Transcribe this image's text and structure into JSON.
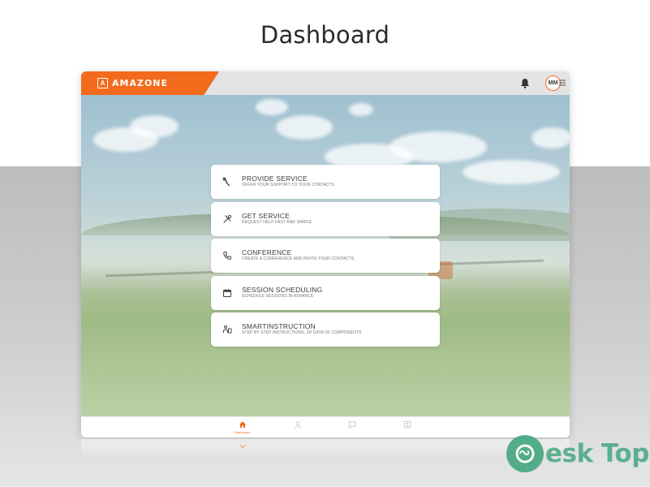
{
  "page": {
    "heading": "Dashboard"
  },
  "app": {
    "brand": {
      "logo_letter": "A",
      "name": "AMAZONE",
      "color": "#f26a1b"
    },
    "header": {
      "avatar_initials": "MM",
      "bell_icon": "bell-icon",
      "menu_icon": "menu-icon"
    }
  },
  "services": [
    {
      "title": "PROVIDE SERVICE",
      "subtitle": "OFFER YOUR SUPPORT TO YOUR CONTACTS",
      "icon": "wrench-icon"
    },
    {
      "title": "GET SERVICE",
      "subtitle": "REQUEST HELP FAST AND SIMPLE",
      "icon": "tools-icon"
    },
    {
      "title": "CONFERENCE",
      "subtitle": "CREATE A CONFERENCE AND INVITE YOUR CONTACTS",
      "icon": "phone-icon"
    },
    {
      "title": "SESSION SCHEDULING",
      "subtitle": "SCHEDULE SESSIONS IN ADVANCE",
      "icon": "calendar-icon"
    },
    {
      "title": "SMARTINSTRUCTION",
      "subtitle": "STEP BY STEP INSTRUCTIONS, 3D DATA OF COMPONENTS",
      "icon": "instruction-icon"
    }
  ],
  "bottom_nav": [
    {
      "label": "Dashboard",
      "icon": "home-icon",
      "active": true
    },
    {
      "label": "",
      "icon": "service-icon",
      "active": false
    },
    {
      "label": "",
      "icon": "chat-icon",
      "active": false
    },
    {
      "label": "",
      "icon": "contacts-icon",
      "active": false
    }
  ],
  "watermark": {
    "text": "esk Top"
  },
  "colors": {
    "accent": "#f26a1b",
    "watermark": "#3aa37a"
  }
}
